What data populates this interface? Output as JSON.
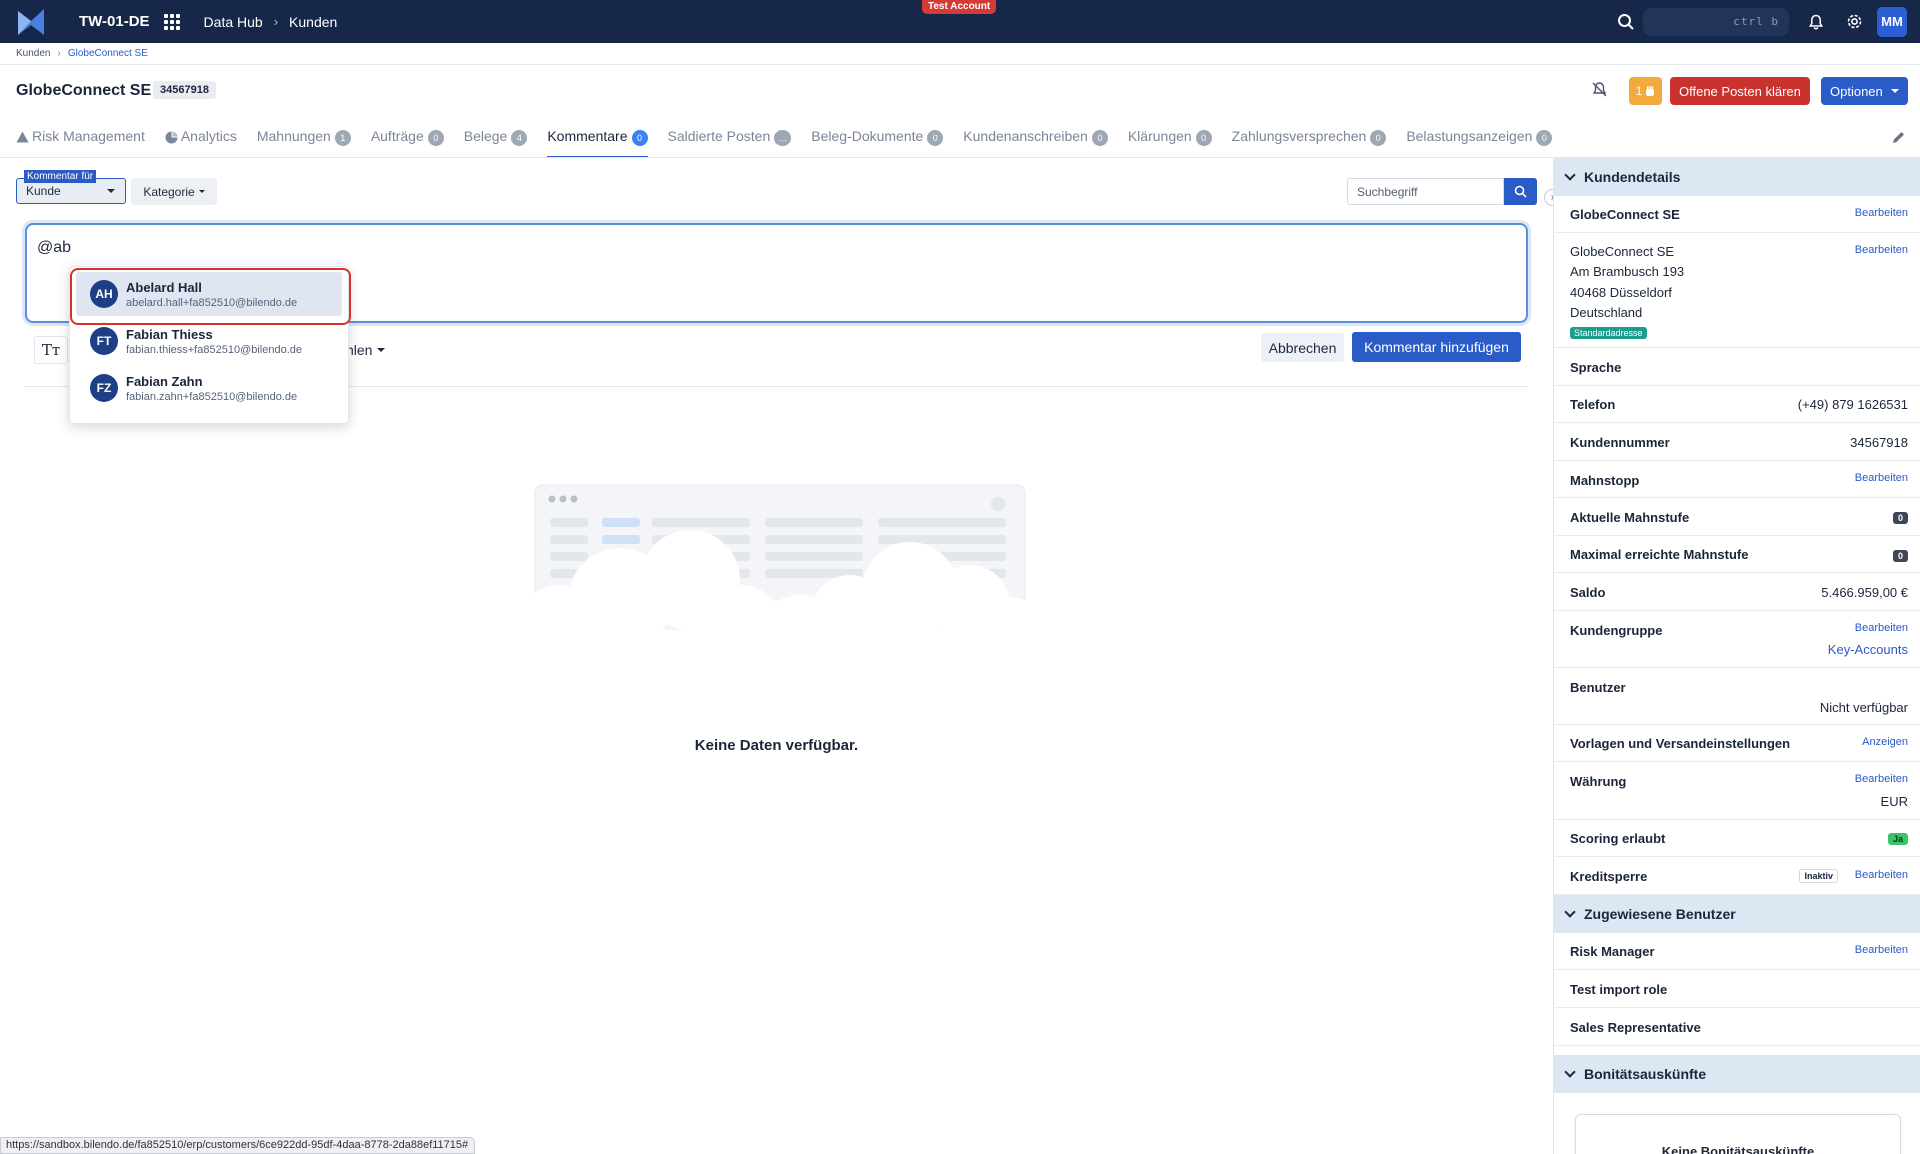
{
  "topnav": {
    "tenant": "TW-01-DE",
    "nav": [
      "Data Hub",
      "Kunden"
    ],
    "test_badge": "Test Account",
    "search_shortcut": "ctrl  b",
    "user_initials": "MM"
  },
  "breadcrumb": [
    "Kunden",
    "GlobeConnect SE"
  ],
  "header": {
    "title": "GlobeConnect SE",
    "customer_number": "34567918",
    "task_count": "1",
    "btn_clear": "Offene Posten klären",
    "btn_options": "Optionen"
  },
  "tabs": [
    {
      "label": "Risk Management",
      "count": null,
      "icon": "warning-icon"
    },
    {
      "label": "Analytics",
      "count": null,
      "icon": "pie-chart-icon"
    },
    {
      "label": "Mahnungen",
      "count": "1"
    },
    {
      "label": "Aufträge",
      "count": "0"
    },
    {
      "label": "Belege",
      "count": "4"
    },
    {
      "label": "Kommentare",
      "count": "0",
      "active": true
    },
    {
      "label": "Saldierte Posten",
      "count": "…"
    },
    {
      "label": "Beleg-Dokumente",
      "count": "0"
    },
    {
      "label": "Kundenanschreiben",
      "count": "0"
    },
    {
      "label": "Klärungen",
      "count": "0"
    },
    {
      "label": "Zahlungsversprechen",
      "count": "0"
    },
    {
      "label": "Belastungsanzeigen",
      "count": "0"
    }
  ],
  "filters": {
    "comment_for_label": "Kommentar für",
    "comment_for_value": "Kunde",
    "category": "Kategorie",
    "search_placeholder": "Suchbegriff"
  },
  "composer": {
    "text": "@ab",
    "choose_label": "hlen",
    "cancel": "Abbrechen",
    "add": "Kommentar hinzufügen"
  },
  "mentions": [
    {
      "initials": "AH",
      "name": "Abelard Hall",
      "email": "abelard.hall+fa852510@bilendo.de",
      "selected": true
    },
    {
      "initials": "FT",
      "name": "Fabian Thiess",
      "email": "fabian.thiess+fa852510@bilendo.de"
    },
    {
      "initials": "FZ",
      "name": "Fabian Zahn",
      "email": "fabian.zahn+fa852510@bilendo.de"
    }
  ],
  "empty_state": "Keine Daten verfügbar.",
  "status_url": "https://sandbox.bilendo.de/fa852510/erp/customers/6ce922dd-95df-4daa-8778-2da88ef11715#",
  "sidebar": {
    "section_details": "Kundendetails",
    "name": "GlobeConnect SE",
    "edit": "Bearbeiten",
    "address": [
      "GlobeConnect SE",
      "Am Brambusch 193",
      "40468 Düsseldorf",
      "Deutschland"
    ],
    "address_badge": "Standardadresse",
    "rows": {
      "sprache": "Sprache",
      "telefon": "Telefon",
      "telefon_val": "(+49) 879 1626531",
      "kundennummer": "Kundennummer",
      "kundennummer_val": "34567918",
      "mahnstopp": "Mahnstopp",
      "aktuelle": "Aktuelle Mahnstufe",
      "aktuelle_val": "0",
      "maximal": "Maximal erreichte Mahnstufe",
      "maximal_val": "0",
      "saldo": "Saldo",
      "saldo_val": "5.466.959,00 €",
      "kundengruppe": "Kundengruppe",
      "kundengruppe_val": "Key-Accounts",
      "benutzer": "Benutzer",
      "benutzer_val": "Nicht verfügbar",
      "vorlagen": "Vorlagen und Versandeinstellungen",
      "anzeigen": "Anzeigen",
      "waehrung": "Währung",
      "waehrung_val": "EUR",
      "scoring": "Scoring erlaubt",
      "scoring_val": "Ja",
      "kreditsperre": "Kreditsperre",
      "kreditsperre_val": "Inaktiv"
    },
    "section_users": "Zugewiesene Benutzer",
    "users": [
      "Risk Manager",
      "Test import role",
      "Sales Representative"
    ],
    "section_credit": "Bonitätsauskünfte",
    "credit_empty": "Keine Bonitätsauskünfte"
  },
  "colors": {
    "nav_bg": "#172749",
    "primary": "#2a5bc7",
    "danger": "#c8332d",
    "warning": "#f3a93b",
    "success": "#3bc46a"
  }
}
